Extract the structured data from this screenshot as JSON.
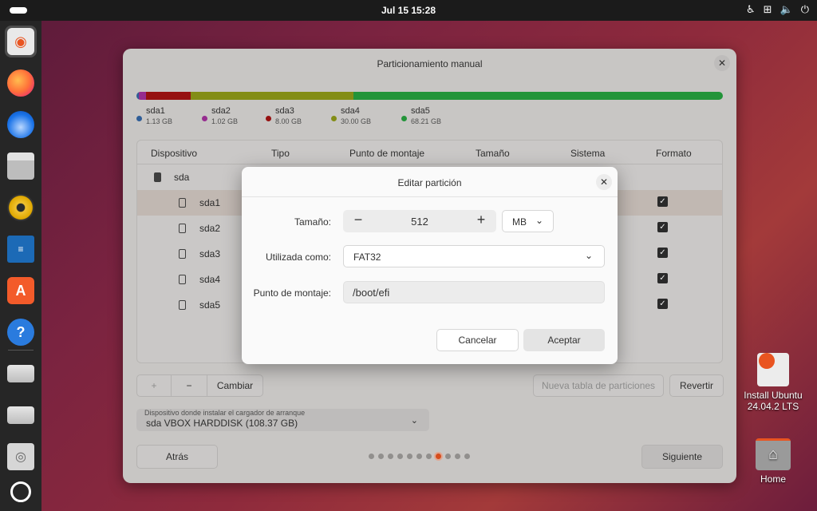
{
  "topbar": {
    "clock": "Jul 15  15:28",
    "icons": [
      "accessibility-icon",
      "network-icon",
      "volume-icon",
      "power-icon"
    ]
  },
  "dock": {
    "apps": [
      "install-ubuntu",
      "firefox",
      "thunderbird",
      "files",
      "rhythmbox",
      "libreoffice-writer",
      "app-center",
      "help",
      "drive",
      "drive",
      "disc",
      "show-apps"
    ]
  },
  "desktop": {
    "install_label_line1": "Install Ubuntu",
    "install_label_line2": "24.04.2 LTS",
    "home_label": "Home"
  },
  "window": {
    "title": "Particionamiento manual",
    "partitions": [
      {
        "name": "sda1",
        "size": "1.13 GB",
        "color": "#3465a4"
      },
      {
        "name": "sda2",
        "size": "1.02 GB",
        "color": "#a3309c"
      },
      {
        "name": "sda3",
        "size": "8.00 GB",
        "color": "#a31313"
      },
      {
        "name": "sda4",
        "size": "30.00 GB",
        "color": "#8f9918"
      },
      {
        "name": "sda5",
        "size": "68.21 GB",
        "color": "#26a13e"
      }
    ],
    "columns": {
      "device": "Dispositivo",
      "type": "Tipo",
      "mount": "Punto de montaje",
      "size": "Tamaño",
      "system": "Sistema",
      "format": "Formato"
    },
    "disk_row": "sda",
    "rows": [
      {
        "device": "sda1",
        "format": true
      },
      {
        "device": "sda2",
        "format": true
      },
      {
        "device": "sda3",
        "format": true
      },
      {
        "device": "sda4",
        "format": true
      },
      {
        "device": "sda5",
        "format": true
      }
    ],
    "buttons": {
      "add": "+",
      "remove": "−",
      "change": "Cambiar",
      "new_table": "Nueva tabla de particiones",
      "revert": "Revertir",
      "back": "Atrás",
      "next": "Siguiente"
    },
    "bootloader": {
      "caption": "Dispositivo donde instalar el cargador de arranque",
      "value": "sda VBOX HARDDISK (108.37 GB)"
    },
    "steps": {
      "total": 11,
      "current": 7
    }
  },
  "dialog": {
    "title": "Editar partición",
    "size_label": "Tamaño:",
    "size_value": "512",
    "size_unit": "MB",
    "used_as_label": "Utilizada como:",
    "used_as_value": "FAT32",
    "mount_label": "Punto de montaje:",
    "mount_value": "/boot/efi",
    "cancel": "Cancelar",
    "accept": "Aceptar"
  }
}
